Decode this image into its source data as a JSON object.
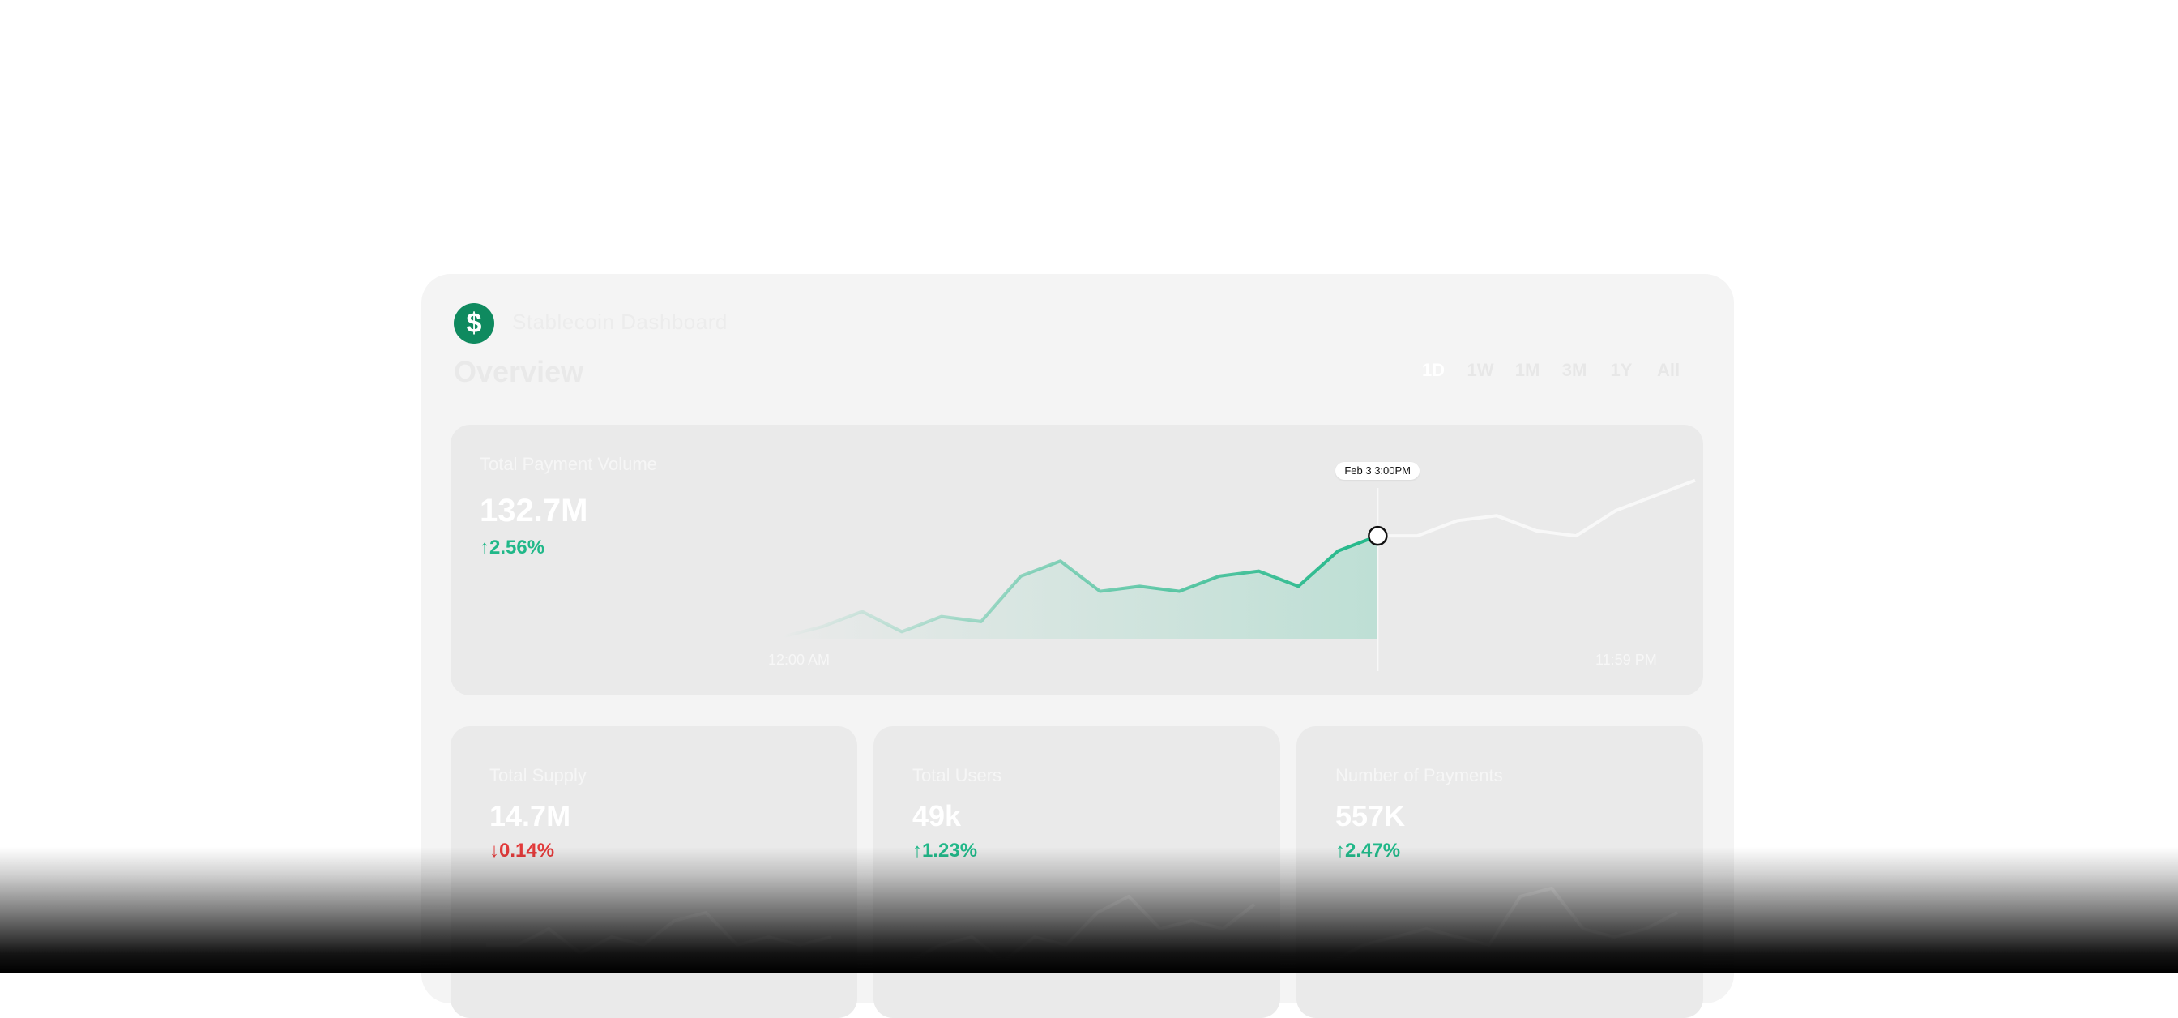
{
  "header": {
    "brand_name": "Stablecoin Dashboard",
    "page_title": "Overview",
    "range_tabs": [
      "1D",
      "1W",
      "1M",
      "3M",
      "1Y",
      "All"
    ]
  },
  "main_card": {
    "label": "Total Payment Volume",
    "value": "132.7M",
    "change": "2.56%",
    "change_direction": "up",
    "tooltip": "Feb 3 3:00PM",
    "x_start_label": "12:00 AM",
    "x_end_label": "11:59 PM"
  },
  "mini_cards": [
    {
      "label": "Total Supply",
      "value": "14.7M",
      "change": "0.14%",
      "change_direction": "down"
    },
    {
      "label": "Total Users",
      "value": "49k",
      "change": "1.23%",
      "change_direction": "up"
    },
    {
      "label": "Number of Payments",
      "value": "557K",
      "change": "2.47%",
      "change_direction": "up"
    }
  ],
  "colors": {
    "accent": "#21b889",
    "negative": "#e23b3b",
    "brand": "#0f8a5f"
  },
  "chart_data": [
    {
      "type": "area",
      "x": [
        0,
        1,
        2,
        3,
        4,
        5,
        6,
        7,
        8,
        9,
        10,
        11,
        12,
        13,
        14,
        15,
        16,
        17,
        18,
        19,
        20,
        21,
        22,
        23
      ],
      "values": [
        2,
        4,
        7,
        3,
        6,
        5,
        14,
        17,
        11,
        12,
        11,
        14,
        15,
        12,
        19,
        22,
        22,
        25,
        26,
        23,
        22,
        27,
        30,
        33
      ],
      "highlight_index": 15,
      "ylim": [
        0,
        36
      ]
    },
    {
      "type": "line",
      "values": [
        3,
        3,
        5,
        2,
        4,
        3,
        6,
        7,
        3,
        4,
        3,
        4
      ],
      "ylim": [
        0,
        10
      ]
    },
    {
      "type": "line",
      "values": [
        1,
        3,
        4,
        1,
        4,
        3,
        7,
        9,
        5,
        6,
        5,
        8
      ],
      "ylim": [
        0,
        10
      ]
    },
    {
      "type": "line",
      "values": [
        1,
        3,
        4,
        5,
        4,
        3,
        9,
        10,
        5,
        4,
        5,
        7
      ],
      "ylim": [
        0,
        10
      ]
    }
  ]
}
